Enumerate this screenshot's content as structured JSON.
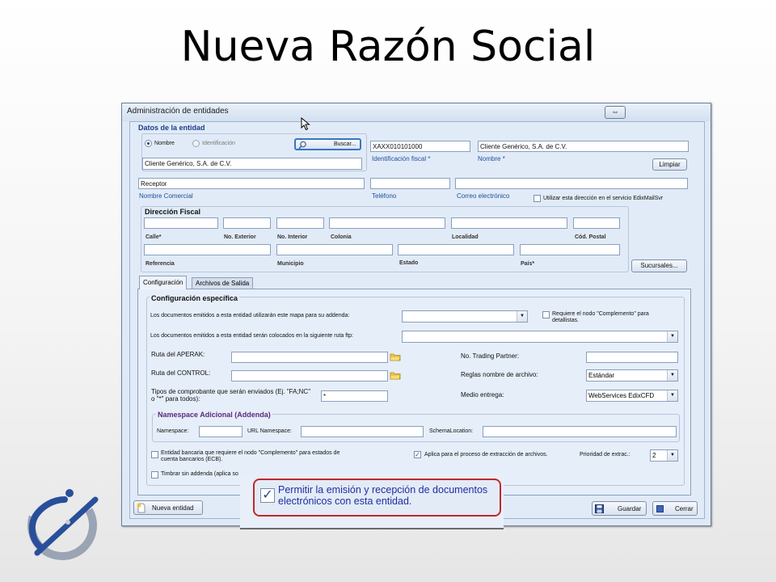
{
  "slide": {
    "title": "Nueva Razón Social"
  },
  "window": {
    "title": "Administración de entidades",
    "restore_glyph": "⇔"
  },
  "entity": {
    "section_label": "Datos de la entidad",
    "radio_nombre": "Nombre",
    "radio_identificacion": "Identificación",
    "search_button": "Buscar...",
    "search_value": "Cliente Genérico, S.A. de C.V.",
    "rfc_value": "XAXX010101000",
    "rfc_label": "Identificación fiscal *",
    "name_value": "Cliente Genérico, S.A. de C.V.",
    "name_label": "Nombre *",
    "clear_button": "Limpiar",
    "commercial_value": "Receptor",
    "commercial_label": "Nombre Comercial",
    "phone_label": "Teléfono",
    "email_label": "Correo electrónico",
    "email_service_label": "Utilizar esta dirección en el servicio EdixMailSvr"
  },
  "address": {
    "section_label": "Dirección Fiscal",
    "calle": "Calle*",
    "no_exterior": "No. Exterior",
    "no_interior": "No. Interior",
    "colonia": "Colonia",
    "localidad": "Localidad",
    "cod_postal": "Cód. Postal",
    "referencia": "Referencia",
    "municipio": "Municipio",
    "estado": "Estado",
    "pais": "País*",
    "branches_button": "Sucursales..."
  },
  "tabs": [
    {
      "label": "Configuración"
    },
    {
      "label": "Archivos de Salida"
    }
  ],
  "config": {
    "section_label": "Configuración específica",
    "addenda_map_label": "Los documentos emitidos a esta entidad utilizarán este mapa para su addenda:",
    "complemento_label": "Requiere el nodo \"Complemento\" para detallistas.",
    "ftp_label": "Los documentos emitidos a esta entidad serán colocados en la siguiente ruta ftp:",
    "aperak_label": "Ruta del APERAK:",
    "control_label": "Ruta del CONTROL:",
    "tipos_label": "Tipos de comprobante que serán enviados (Ej. \"FA;NC\" o \"*\" para todos):",
    "tipos_value": "*",
    "trading_partner_label": "No. Trading Partner:",
    "reglas_label": "Reglas nombre de archivo:",
    "reglas_value": "Estándar",
    "medio_label": "Medio entrega:",
    "medio_value": "WebServices EdixCFD"
  },
  "namespace": {
    "section_label": "Namespace Adicional (Addenda)",
    "namespace_label": "Namespace:",
    "url_label": "URL Namespace:",
    "schema_label": "SchemaLocation:"
  },
  "options": {
    "bank_label": "Entidad bancaria que requiere el nodo \"Complemento\" para estados de cuenta bancarios (ECB).",
    "extract_label": "Aplica para el proceso de extracción de archivos.",
    "priority_label": "Prioridad de extrac.:",
    "priority_value": "2",
    "no_addenda_label": "Timbrar sin addenda (aplica so"
  },
  "callout": {
    "text": "Permitir la emisión y recepción de documentos electrónicos con esta entidad."
  },
  "footer": {
    "new_button": "Nueva entidad",
    "save_button": "Guardar",
    "close_button": "Cerrar"
  },
  "colors": {
    "callout_border": "#c0282d",
    "section_blue": "#1a3e8c",
    "namespace_purple": "#5a2a7a"
  }
}
